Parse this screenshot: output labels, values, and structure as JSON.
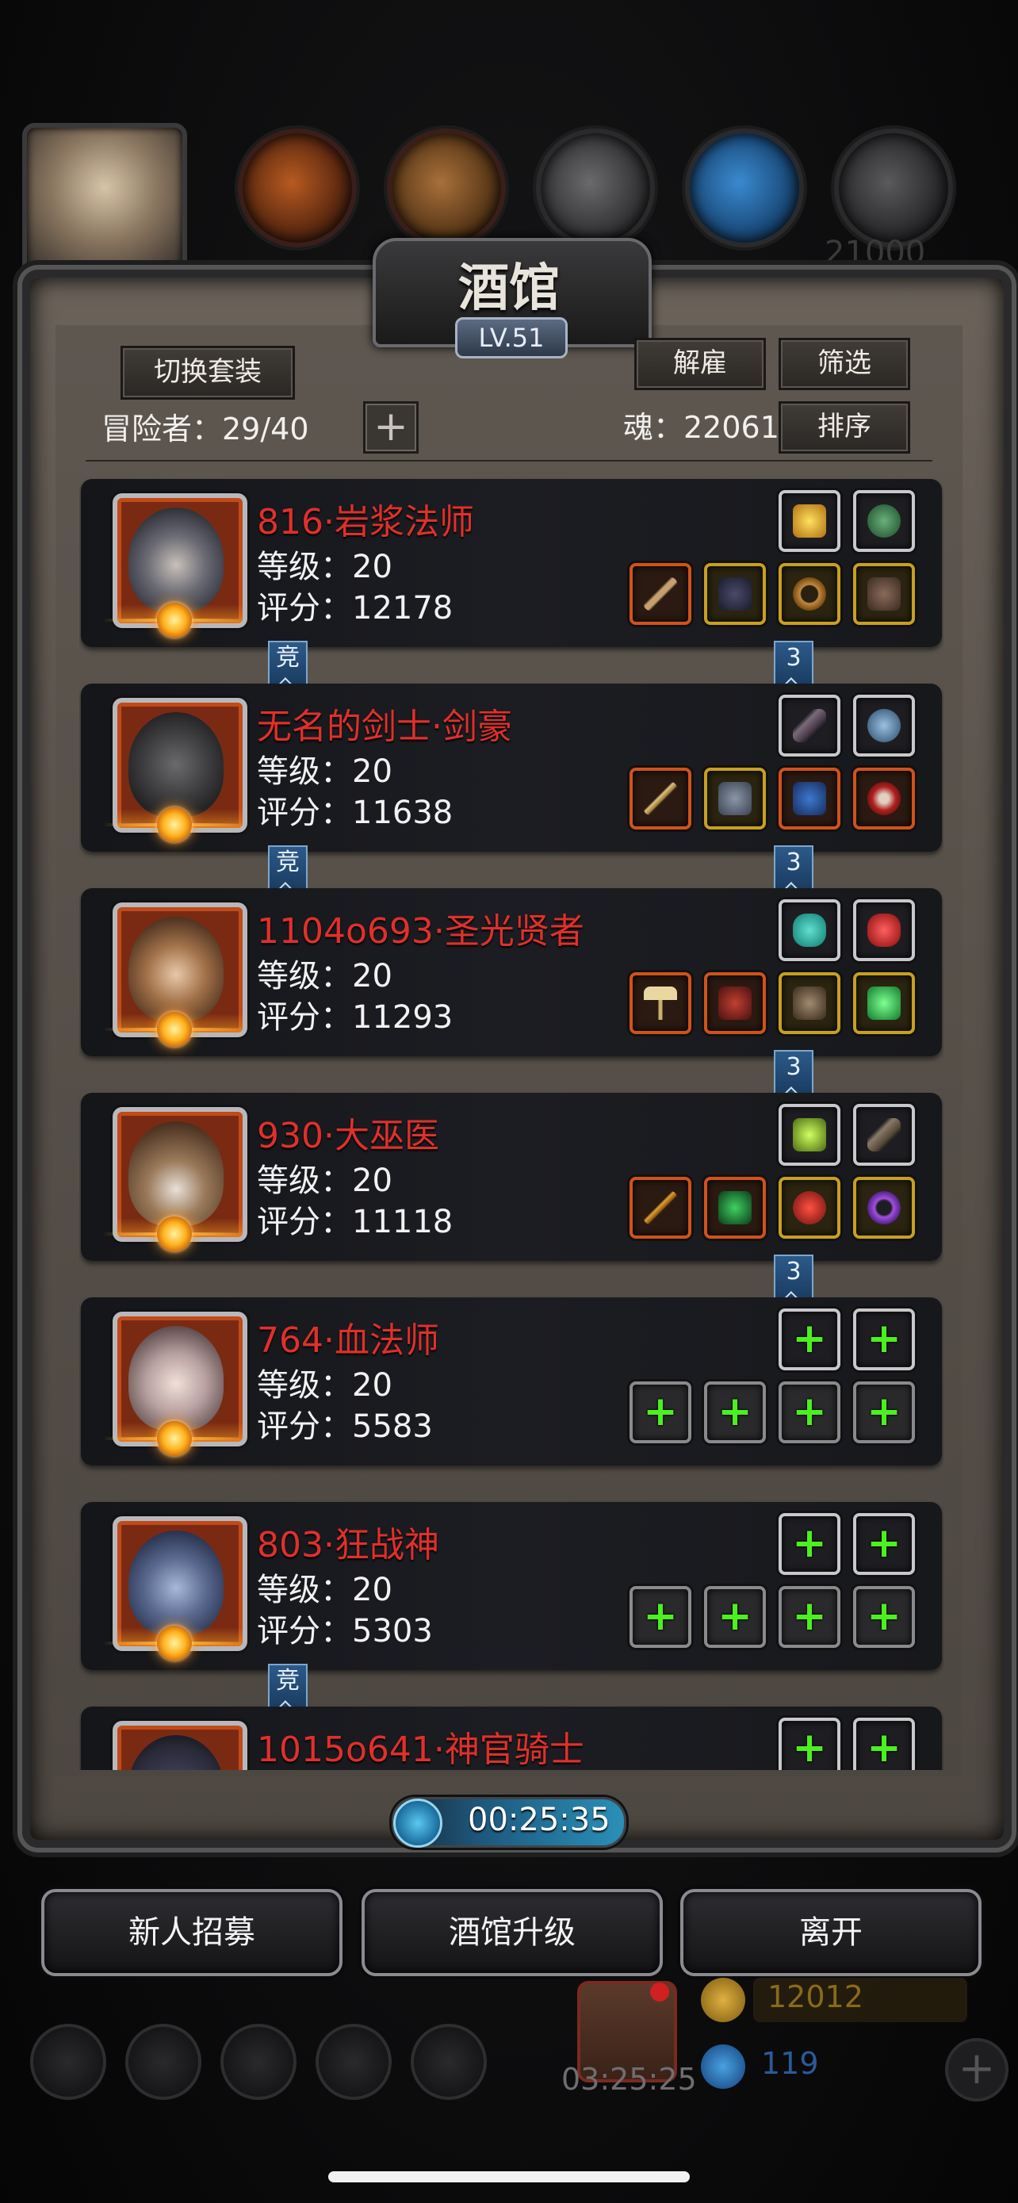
{
  "background": {
    "top_number": "21000"
  },
  "header": {
    "title": "酒馆",
    "level": "LV.51",
    "switch_set_label": "切换套装",
    "adventurers_text": "冒险者：29/40",
    "dismiss_label": "解雇",
    "filter_label": "筛选",
    "soul_text": "魂：22061",
    "sort_label": "排序"
  },
  "heroes": [
    {
      "name": "816·岩浆法师",
      "level": "等级：20",
      "score": "评分：12178",
      "tag_left": "竞",
      "tag_right": "3"
    },
    {
      "name": "无名的剑士·剑豪",
      "level": "等级：20",
      "score": "评分：11638",
      "tag_left": "竞",
      "tag_right": "3"
    },
    {
      "name": "1104o693·圣光贤者",
      "level": "等级：20",
      "score": "评分：11293",
      "tag_left": "",
      "tag_right": "3"
    },
    {
      "name": "930·大巫医",
      "level": "等级：20",
      "score": "评分：11118",
      "tag_left": "",
      "tag_right": "3"
    },
    {
      "name": "764·血法师",
      "level": "等级：20",
      "score": "评分：5583",
      "tag_left": "",
      "tag_right": ""
    },
    {
      "name": "803·狂战神",
      "level": "等级：20",
      "score": "评分：5303",
      "tag_left": "竞",
      "tag_right": ""
    },
    {
      "name": "1015o641·神官骑士",
      "level": "",
      "score": "",
      "tag_left": "",
      "tag_right": ""
    }
  ],
  "timer": "00:25:35",
  "buttons": {
    "recruit": "新人招募",
    "upgrade": "酒馆升级",
    "leave": "离开"
  },
  "bottom_bar": {
    "gift_timer": "03:25:25",
    "gold": "12012",
    "crystal": "119",
    "add": "+"
  },
  "colors": {
    "hero_name": "#e0302a",
    "empty_slot_plus": "#4cf020",
    "tag_blue": "#2c5a8a"
  }
}
